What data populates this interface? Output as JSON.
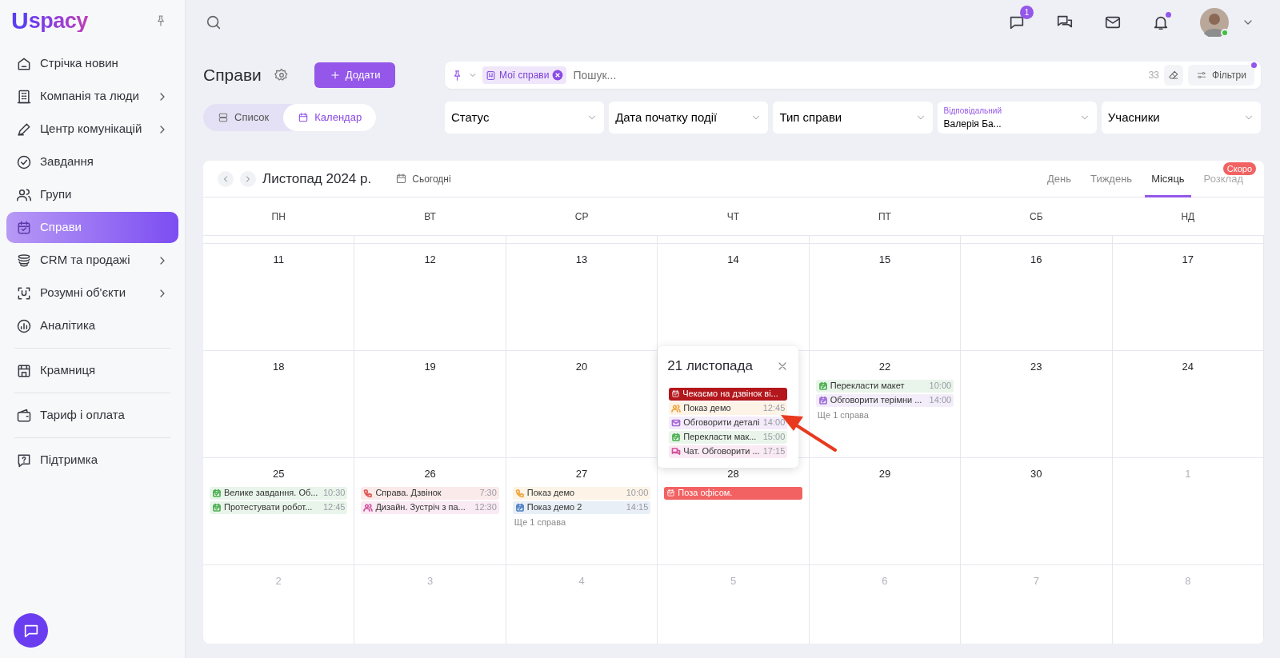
{
  "logo": {
    "mark": "U",
    "text": "spacy"
  },
  "sidebar": {
    "sections": [
      {
        "items": [
          {
            "label": "Стрічка новин",
            "selected": false,
            "has_submenu": false
          },
          {
            "label": "Компанія та люди",
            "selected": false,
            "has_submenu": true
          },
          {
            "label": "Центр комунікацій",
            "selected": false,
            "has_submenu": true
          },
          {
            "label": "Завдання",
            "selected": false,
            "has_submenu": false
          },
          {
            "label": "Групи",
            "selected": false,
            "has_submenu": false
          },
          {
            "label": "Справи",
            "selected": true,
            "has_submenu": false
          },
          {
            "label": "CRM та продажі",
            "selected": false,
            "has_submenu": true
          },
          {
            "label": "Розумні об'єкти",
            "selected": false,
            "has_submenu": true
          },
          {
            "label": "Аналітика",
            "selected": false,
            "has_submenu": false
          }
        ]
      },
      {
        "items": [
          {
            "label": "Крамниця",
            "selected": false,
            "has_submenu": false
          }
        ]
      },
      {
        "items": [
          {
            "label": "Тариф і оплата",
            "selected": false,
            "has_submenu": false
          }
        ]
      },
      {
        "items": [
          {
            "label": "Підтримка",
            "selected": false,
            "has_submenu": false
          }
        ]
      }
    ]
  },
  "topbar": {
    "chat_badge": "1",
    "notifications_dot": true,
    "user_online": true
  },
  "page": {
    "title": "Справи",
    "add_button": "Додати",
    "views": [
      {
        "label": "Список",
        "selected": false
      },
      {
        "label": "Календар",
        "selected": true
      }
    ],
    "search": {
      "chip": "Мої справи",
      "placeholder": "Пошук...",
      "count": "33",
      "filters_button": "Фільтри",
      "filters_active": true
    },
    "filters": [
      {
        "label": "Статус"
      },
      {
        "label": "Дата початку події"
      },
      {
        "label": "Тип справи"
      },
      {
        "label": "Відповідальний",
        "value": "Валерія Ба..."
      },
      {
        "label": "Учасники"
      }
    ]
  },
  "calendar": {
    "title": "Листопад 2024 р.",
    "today_button": "Сьогодні",
    "modes": [
      {
        "label": "День",
        "selected": false,
        "disabled": false
      },
      {
        "label": "Тиждень",
        "selected": false,
        "disabled": false
      },
      {
        "label": "Місяць",
        "selected": true,
        "disabled": false
      },
      {
        "label": "Розклад",
        "selected": false,
        "disabled": true,
        "badge": "Скоро"
      }
    ],
    "weekdays": [
      "ПН",
      "ВТ",
      "СР",
      "ЧТ",
      "ПТ",
      "СБ",
      "НД"
    ],
    "weeks": [
      {
        "days": [
          {
            "number": "11",
            "other_month": false
          },
          {
            "number": "12",
            "other_month": false
          },
          {
            "number": "13",
            "other_month": false
          },
          {
            "number": "14",
            "other_month": false
          },
          {
            "number": "15",
            "other_month": false
          },
          {
            "number": "16",
            "other_month": false
          },
          {
            "number": "17",
            "other_month": false
          }
        ]
      },
      {
        "days": [
          {
            "number": "18",
            "other_month": false
          },
          {
            "number": "19",
            "other_month": false
          },
          {
            "number": "20",
            "other_month": false
          },
          {
            "popup": {
              "title": "21 листопада",
              "annotation_arrow": true,
              "events": [
                {
                  "kind": "task",
                  "title": "Чекаємо на дзвінок ві...",
                  "color": "#b3161b",
                  "filled": true
                },
                {
                  "kind": "meeting",
                  "title": "Показ демо",
                  "time": "12:45",
                  "color": "#f0a43c",
                  "filled": false
                },
                {
                  "kind": "email",
                  "title": "Обговорити деталі",
                  "time": "14:00",
                  "color": "#a764d8",
                  "filled": false
                },
                {
                  "kind": "task",
                  "title": "Перекласти мак...",
                  "time": "15:00",
                  "color": "#4caf50",
                  "filled": false
                },
                {
                  "kind": "chat",
                  "title": "Чат. Обговорити ...",
                  "time": "17:15",
                  "color": "#d0509a",
                  "filled": false
                }
              ]
            }
          },
          {
            "number": "22",
            "other_month": false,
            "events": [
              {
                "kind": "task",
                "title": "Перекласти макет",
                "time": "10:00",
                "color": "#4caf50",
                "filled": false
              },
              {
                "kind": "task",
                "title": "Обговорити терімни ...",
                "time": "14:00",
                "color": "#9b6ad8",
                "filled": false
              }
            ],
            "more": "Ще 1 справа"
          },
          {
            "number": "23",
            "other_month": false
          },
          {
            "number": "24",
            "other_month": false
          }
        ]
      },
      {
        "days": [
          {
            "number": "25",
            "other_month": false,
            "events": [
              {
                "kind": "task",
                "title": "Велике завдання. Об...",
                "time": "10:30",
                "color": "#4caf50",
                "filled": false
              },
              {
                "kind": "task",
                "title": "Протестувати робот...",
                "time": "12:45",
                "color": "#4caf50",
                "filled": false
              }
            ]
          },
          {
            "number": "26",
            "other_month": false,
            "events": [
              {
                "kind": "call",
                "title": "Справа. Дзвінок",
                "time": "7:30",
                "color": "#e0524f",
                "filled": false
              },
              {
                "kind": "meeting",
                "title": "Дизайн. Зустріч з па...",
                "time": "12:30",
                "color": "#d0509a",
                "filled": false
              }
            ]
          },
          {
            "number": "27",
            "other_month": false,
            "events": [
              {
                "kind": "call",
                "title": "Показ демо",
                "time": "10:00",
                "color": "#f0a43c",
                "filled": false
              },
              {
                "kind": "task",
                "title": "Показ демо 2",
                "time": "14:15",
                "color": "#4a7fc1",
                "filled": false
              }
            ],
            "more": "Ще 1 справа"
          },
          {
            "number": "28",
            "other_month": false,
            "events": [
              {
                "kind": "task",
                "title": "Поза офісом.",
                "color": "#f26262",
                "filled": true
              }
            ]
          },
          {
            "number": "29",
            "other_month": false
          },
          {
            "number": "30",
            "other_month": false
          },
          {
            "number": "1",
            "other_month": true
          }
        ]
      },
      {
        "days": [
          {
            "number": "2",
            "other_month": true
          },
          {
            "number": "3",
            "other_month": true
          },
          {
            "number": "4",
            "other_month": true
          },
          {
            "number": "5",
            "other_month": true
          },
          {
            "number": "6",
            "other_month": true
          },
          {
            "number": "7",
            "other_month": true
          },
          {
            "number": "8",
            "other_month": true
          }
        ]
      }
    ]
  }
}
